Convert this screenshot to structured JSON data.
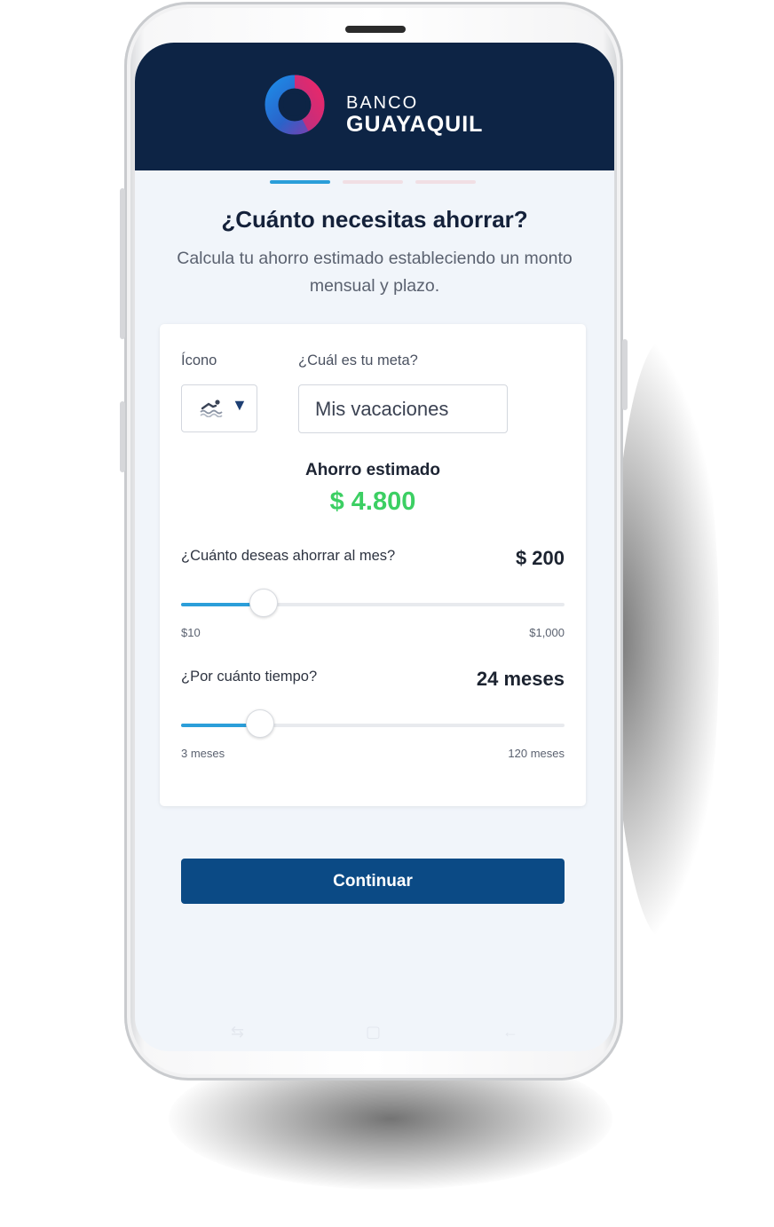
{
  "brand": {
    "line1": "BANCO",
    "line2": "GUAYAQUIL",
    "logo_icon": "banco-guayaquil-ring-logo",
    "colors": {
      "header": "#0d2445",
      "ring_blue": "#1a7ad6",
      "ring_pink": "#e02a6b"
    }
  },
  "stepper": {
    "total_steps": 3,
    "current_step": 1,
    "active_color": "#2b9ed9"
  },
  "page": {
    "title": "¿Cuánto necesitas ahorrar?",
    "subtitle": "Calcula tu ahorro estimado estableciendo un monto mensual y plazo."
  },
  "form": {
    "icon_label": "Ícono",
    "icon_value": "swimmer-icon",
    "goal_label": "¿Cuál es tu meta?",
    "goal_value": "Mis vacaciones",
    "estimate_label": "Ahorro estimado",
    "estimate_value": "$ 4.800",
    "estimate_color": "#3ccf63",
    "monthly": {
      "question": "¿Cuánto deseas ahorrar al mes?",
      "value": "$ 200",
      "min_label": "$10",
      "max_label": "$1,000",
      "fraction": 0.215
    },
    "term": {
      "question": "¿Por cuánto tiempo?",
      "value": "24 meses",
      "min_label": "3 meses",
      "max_label": "120 meses",
      "fraction": 0.205
    }
  },
  "actions": {
    "continue_label": "Continuar",
    "continue_color": "#0b4a85"
  },
  "navbar": {
    "icons": [
      "recents-icon",
      "home-icon",
      "back-icon"
    ]
  }
}
